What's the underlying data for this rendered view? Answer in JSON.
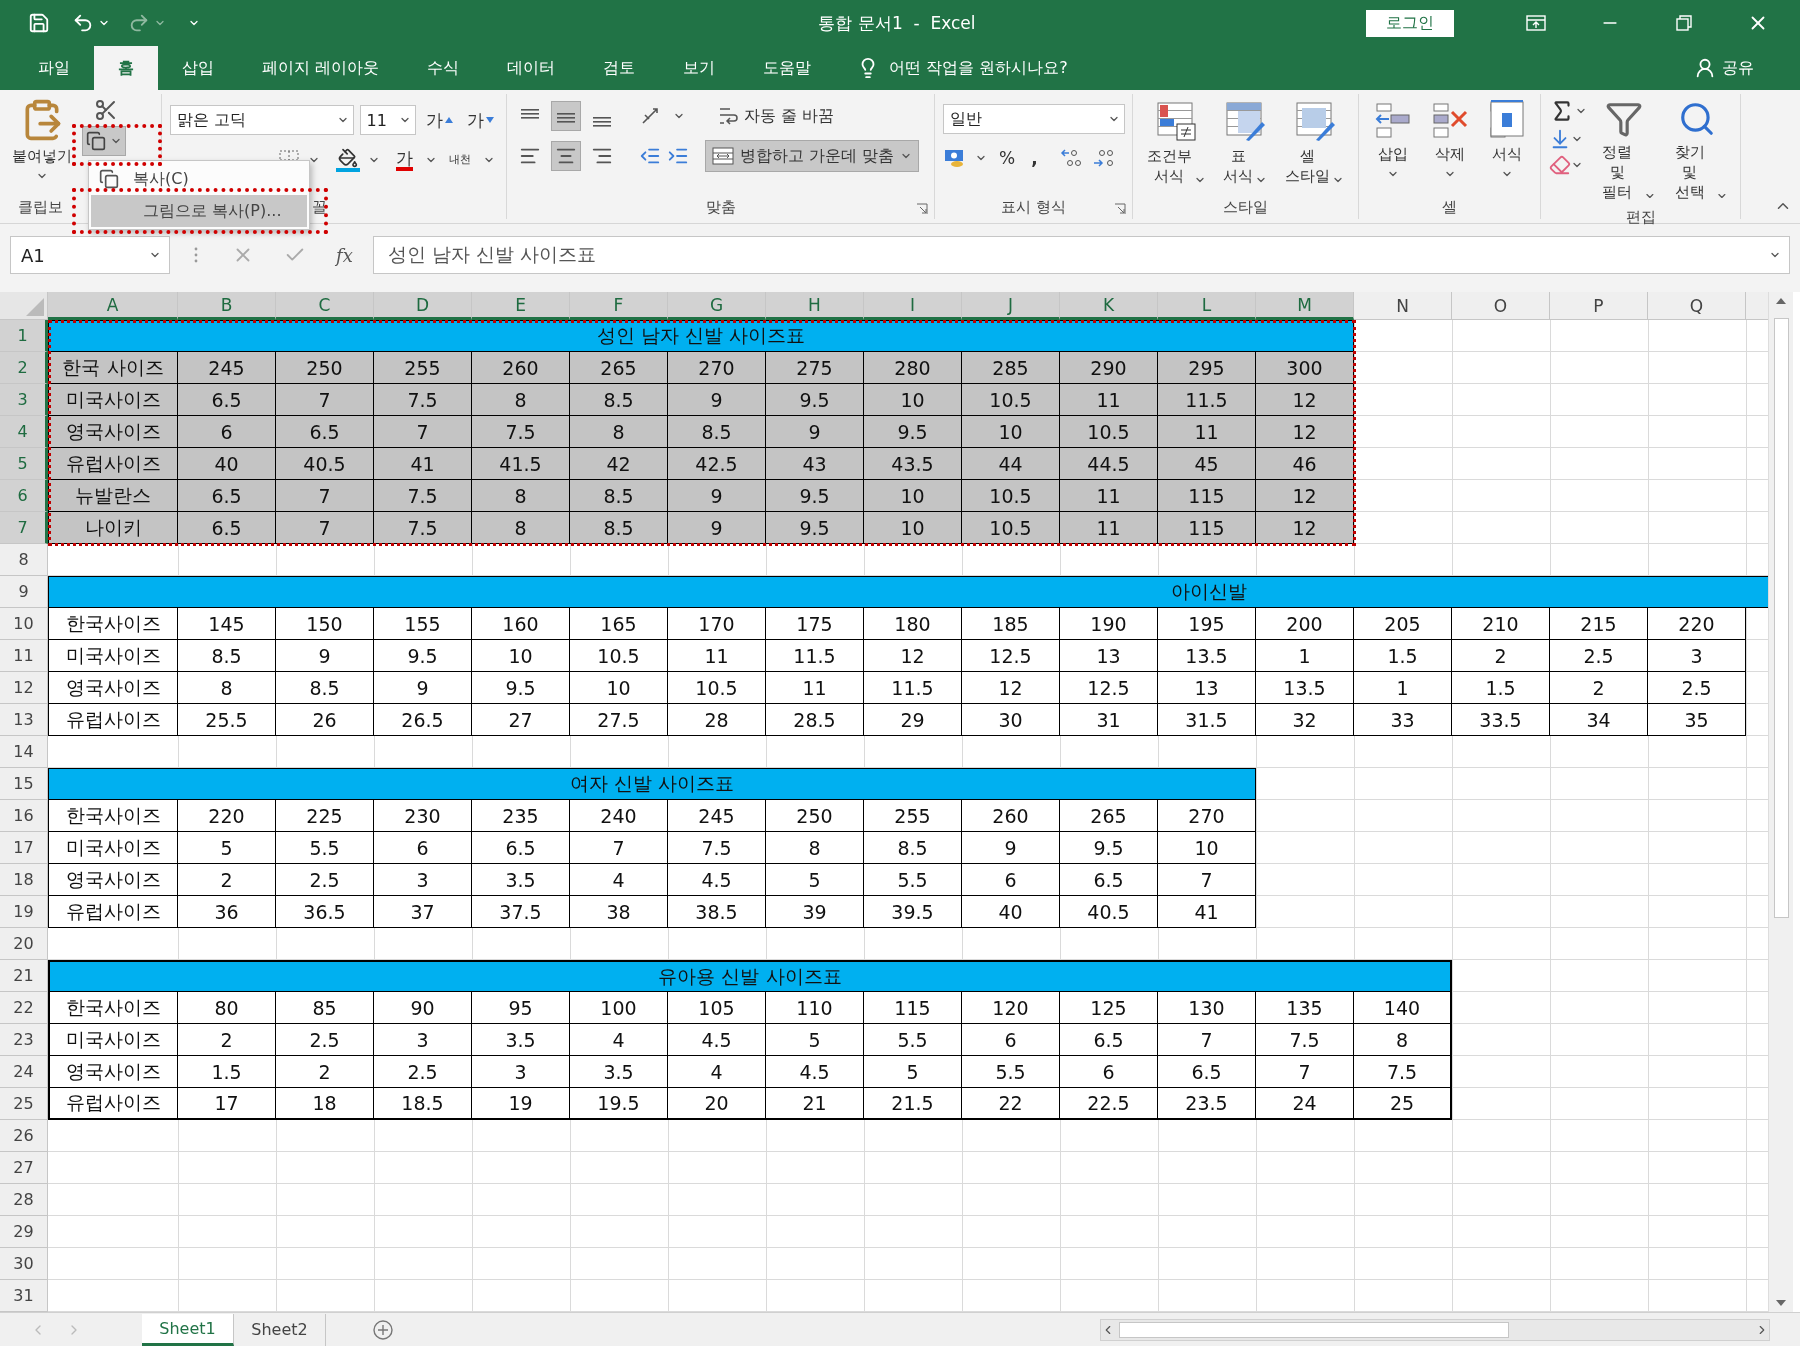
{
  "title_bar": {
    "title": "통합 문서1  -  Excel",
    "sign_in": "로그인"
  },
  "tabs": [
    {
      "label": "파일",
      "selected": false
    },
    {
      "label": "홈",
      "selected": true
    },
    {
      "label": "삽입",
      "selected": false
    },
    {
      "label": "페이지 레이아웃",
      "selected": false
    },
    {
      "label": "수식",
      "selected": false
    },
    {
      "label": "데이터",
      "selected": false
    },
    {
      "label": "검토",
      "selected": false
    },
    {
      "label": "보기",
      "selected": false
    },
    {
      "label": "도움말",
      "selected": false
    }
  ],
  "tell_me": "어떤 작업을 원하시나요?",
  "share": "공유",
  "ribbon": {
    "clipboard": {
      "paste": "붙여넣기",
      "copy": {
        "expanded": true,
        "annotated": true
      },
      "label": "클립보"
    },
    "copy_menu": [
      {
        "label": "복사(C)",
        "selected": false,
        "annotated": false
      },
      {
        "label": "그림으로 복사(P)...",
        "selected": true,
        "annotated": true
      }
    ],
    "font": {
      "name": "맑은 고딕",
      "size": "11",
      "grow": "가",
      "shrink": "가",
      "font_color": "가",
      "phonetic": "내천",
      "label": "꼴"
    },
    "alignment": {
      "vertical": [
        {
          "selected": false
        },
        {
          "selected": true
        },
        {
          "selected": false
        }
      ],
      "horizontal": [
        {
          "selected": false
        },
        {
          "selected": true
        },
        {
          "selected": false
        }
      ],
      "wrap": "자동 줄 바꿈",
      "merge": {
        "label": "병합하고 가운데 맞춤",
        "selected": true
      },
      "label": "맞춤"
    },
    "number": {
      "format": "일반",
      "percent": "%",
      "comma": ",",
      "label": "표시 형식"
    },
    "styles": {
      "buttons": [
        "조건부\n서식",
        "표\n서식",
        "셀\n스타일"
      ],
      "label": "스타일"
    },
    "cells": {
      "buttons": [
        "삽입",
        "삭제",
        "서식"
      ],
      "label": "셀"
    },
    "editing": {
      "buttons": [
        "정렬 및\n필터",
        "찾기 및\n선택"
      ],
      "label": "편집"
    }
  },
  "formula_bar": {
    "name_box": "A1",
    "fx": "fx",
    "value": "성인 남자 신발 사이즈표"
  },
  "sheet": {
    "columns": [
      "A",
      "B",
      "C",
      "D",
      "E",
      "F",
      "G",
      "H",
      "I",
      "J",
      "K",
      "L",
      "M",
      "N",
      "O",
      "P",
      "Q"
    ],
    "blocks": [
      {
        "kind": "table",
        "title_row": "1",
        "title": "성인 남자 신발 사이즈표",
        "selected": true,
        "copied": true,
        "bold_border": false,
        "extends": false,
        "rows": [
          {
            "number": "2",
            "cells": [
              "한국 사이즈",
              "245",
              "250",
              "255",
              "260",
              "265",
              "270",
              "275",
              "280",
              "285",
              "290",
              "295",
              "300"
            ]
          },
          {
            "number": "3",
            "cells": [
              "미국사이즈",
              "6.5",
              "7",
              "7.5",
              "8",
              "8.5",
              "9",
              "9.5",
              "10",
              "10.5",
              "11",
              "11.5",
              "12"
            ]
          },
          {
            "number": "4",
            "cells": [
              "영국사이즈",
              "6",
              "6.5",
              "7",
              "7.5",
              "8",
              "8.5",
              "9",
              "9.5",
              "10",
              "10.5",
              "11",
              "12"
            ]
          },
          {
            "number": "5",
            "cells": [
              "유럽사이즈",
              "40",
              "40.5",
              "41",
              "41.5",
              "42",
              "42.5",
              "43",
              "43.5",
              "44",
              "44.5",
              "45",
              "46"
            ]
          },
          {
            "number": "6",
            "cells": [
              "뉴발란스",
              "6.5",
              "7",
              "7.5",
              "8",
              "8.5",
              "9",
              "9.5",
              "10",
              "10.5",
              "11",
              "115",
              "12"
            ]
          },
          {
            "number": "7",
            "cells": [
              "나이키",
              "6.5",
              "7",
              "7.5",
              "8",
              "8.5",
              "9",
              "9.5",
              "10",
              "10.5",
              "11",
              "115",
              "12"
            ]
          }
        ]
      },
      {
        "kind": "blank",
        "rows": [
          "8"
        ]
      },
      {
        "kind": "table",
        "title_row": "9",
        "title": "아이신발",
        "selected": false,
        "copied": false,
        "bold_border": false,
        "extends": true,
        "rows": [
          {
            "number": "10",
            "cells": [
              "한국사이즈",
              "145",
              "150",
              "155",
              "160",
              "165",
              "170",
              "175",
              "180",
              "185",
              "190",
              "195",
              "200",
              "205",
              "210",
              "215",
              "220"
            ]
          },
          {
            "number": "11",
            "cells": [
              "미국사이즈",
              "8.5",
              "9",
              "9.5",
              "10",
              "10.5",
              "11",
              "11.5",
              "12",
              "12.5",
              "13",
              "13.5",
              "1",
              "1.5",
              "2",
              "2.5",
              "3"
            ]
          },
          {
            "number": "12",
            "cells": [
              "영국사이즈",
              "8",
              "8.5",
              "9",
              "9.5",
              "10",
              "10.5",
              "11",
              "11.5",
              "12",
              "12.5",
              "13",
              "13.5",
              "1",
              "1.5",
              "2",
              "2.5"
            ]
          },
          {
            "number": "13",
            "cells": [
              "유럽사이즈",
              "25.5",
              "26",
              "26.5",
              "27",
              "27.5",
              "28",
              "28.5",
              "29",
              "30",
              "31",
              "31.5",
              "32",
              "33",
              "33.5",
              "34",
              "35"
            ]
          }
        ]
      },
      {
        "kind": "blank",
        "rows": [
          "14"
        ]
      },
      {
        "kind": "table",
        "title_row": "15",
        "title": "여자 신발 사이즈표",
        "selected": false,
        "copied": false,
        "bold_border": false,
        "extends": false,
        "rows": [
          {
            "number": "16",
            "cells": [
              "한국사이즈",
              "220",
              "225",
              "230",
              "235",
              "240",
              "245",
              "250",
              "255",
              "260",
              "265",
              "270"
            ]
          },
          {
            "number": "17",
            "cells": [
              "미국사이즈",
              "5",
              "5.5",
              "6",
              "6.5",
              "7",
              "7.5",
              "8",
              "8.5",
              "9",
              "9.5",
              "10"
            ]
          },
          {
            "number": "18",
            "cells": [
              "영국사이즈",
              "2",
              "2.5",
              "3",
              "3.5",
              "4",
              "4.5",
              "5",
              "5.5",
              "6",
              "6.5",
              "7"
            ]
          },
          {
            "number": "19",
            "cells": [
              "유럽사이즈",
              "36",
              "36.5",
              "37",
              "37.5",
              "38",
              "38.5",
              "39",
              "39.5",
              "40",
              "40.5",
              "41"
            ]
          }
        ]
      },
      {
        "kind": "blank",
        "rows": [
          "20"
        ]
      },
      {
        "kind": "table",
        "title_row": "21",
        "title": "유아용 신발 사이즈표",
        "selected": false,
        "copied": false,
        "bold_border": true,
        "extends": false,
        "rows": [
          {
            "number": "22",
            "cells": [
              "한국사이즈",
              "80",
              "85",
              "90",
              "95",
              "100",
              "105",
              "110",
              "115",
              "120",
              "125",
              "130",
              "135",
              "140"
            ]
          },
          {
            "number": "23",
            "cells": [
              "미국사이즈",
              "2",
              "2.5",
              "3",
              "3.5",
              "4",
              "4.5",
              "5",
              "5.5",
              "6",
              "6.5",
              "7",
              "7.5",
              "8"
            ]
          },
          {
            "number": "24",
            "cells": [
              "영국사이즈",
              "1.5",
              "2",
              "2.5",
              "3",
              "3.5",
              "4",
              "4.5",
              "5",
              "5.5",
              "6",
              "6.5",
              "7",
              "7.5"
            ]
          },
          {
            "number": "25",
            "cells": [
              "유럽사이즈",
              "17",
              "18",
              "18.5",
              "19",
              "19.5",
              "20",
              "21",
              "21.5",
              "22",
              "22.5",
              "23.5",
              "24",
              "25"
            ]
          }
        ]
      },
      {
        "kind": "blank",
        "rows": [
          "26",
          "27",
          "28",
          "29",
          "30",
          "31"
        ]
      }
    ]
  },
  "sheet_tabs": [
    {
      "label": "Sheet1",
      "selected": true
    },
    {
      "label": "Sheet2",
      "selected": false
    }
  ]
}
